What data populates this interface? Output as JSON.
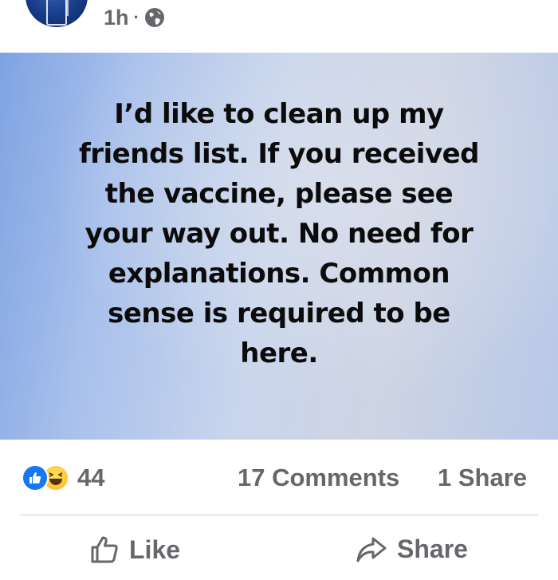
{
  "header": {
    "timestamp": "1h",
    "separator": "·",
    "privacy_icon": "globe-icon"
  },
  "post": {
    "text": "I’d like to clean up my friends list. If you received the vaccine, please see your way out. No need for explanations. Common sense is required to be here.",
    "lines": [
      "I’d like to clean up my",
      "friends list. If you received",
      "the vaccine, please see",
      "your way out. No need for",
      "explanations. Common",
      "sense is required to be",
      "here."
    ]
  },
  "stats": {
    "reaction_icons": [
      "like-reaction-icon",
      "haha-reaction-icon"
    ],
    "reaction_count": "44",
    "comments": "17 Comments",
    "shares": "1 Share"
  },
  "actions": {
    "like_label": "Like",
    "like_icon": "thumbs-up-icon",
    "share_label": "Share",
    "share_icon": "share-arrow-icon"
  },
  "colors": {
    "like_blue": "#1877f2",
    "haha_yellow": "#f7b928",
    "secondary_text": "#65676b",
    "post_text": "#0b0b0b"
  }
}
